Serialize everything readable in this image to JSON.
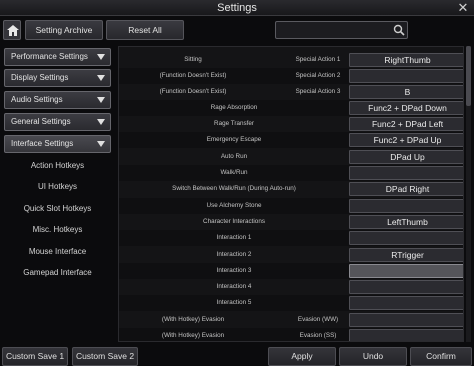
{
  "window": {
    "title": "Settings"
  },
  "toolbar": {
    "setting_archive": "Setting Archive",
    "reset_all": "Reset All",
    "search_placeholder": ""
  },
  "sidebar": {
    "categories": [
      {
        "label": "Performance Settings"
      },
      {
        "label": "Display Settings"
      },
      {
        "label": "Audio Settings"
      },
      {
        "label": "General Settings"
      },
      {
        "label": "Interface Settings"
      }
    ],
    "subitems": [
      {
        "label": "Action Hotkeys"
      },
      {
        "label": "UI Hotkeys"
      },
      {
        "label": "Quick Slot Hotkeys"
      },
      {
        "label": "Misc. Hotkeys"
      },
      {
        "label": "Mouse Interface"
      },
      {
        "label": "Gamepad Interface"
      }
    ]
  },
  "bindings": [
    {
      "name": "Sitting",
      "action": "Special Action 1",
      "key": "RightThumb"
    },
    {
      "name": "(Function Doesn't Exist)",
      "action": "Special Action 2",
      "key": ""
    },
    {
      "name": "(Function Doesn't Exist)",
      "action": "Special Action 3",
      "key": "B"
    },
    {
      "name": "Rage Absorption",
      "action": "",
      "key": "Func2 + DPad Down"
    },
    {
      "name": "Rage Transfer",
      "action": "",
      "key": "Func2 + DPad Left"
    },
    {
      "name": "Emergency Escape",
      "action": "",
      "key": "Func2 + DPad Up"
    },
    {
      "name": "Auto Run",
      "action": "",
      "key": "DPad Up"
    },
    {
      "name": "Walk/Run",
      "action": "",
      "key": ""
    },
    {
      "name": "Switch Between Walk/Run (During Auto-run)",
      "action": "",
      "key": "DPad Right"
    },
    {
      "name": "Use Alchemy Stone",
      "action": "",
      "key": ""
    },
    {
      "name": "Character Interactions",
      "action": "",
      "key": "LeftThumb"
    },
    {
      "name": "Interaction 1",
      "action": "",
      "key": ""
    },
    {
      "name": "Interaction 2",
      "action": "",
      "key": "RTrigger"
    },
    {
      "name": "Interaction 3",
      "action": "",
      "key": ""
    },
    {
      "name": "Interaction 4",
      "action": "",
      "key": ""
    },
    {
      "name": "Interaction 5",
      "action": "",
      "key": ""
    },
    {
      "name": "(With Hotkey) Evasion",
      "action": "Evasion (WW)",
      "key": ""
    },
    {
      "name": "(With Hotkey) Evasion",
      "action": "Evasion (SS)",
      "key": ""
    }
  ],
  "footer": {
    "custom_save_1": "Custom Save 1",
    "custom_save_2": "Custom Save 2",
    "apply": "Apply",
    "undo": "Undo",
    "confirm": "Confirm"
  }
}
